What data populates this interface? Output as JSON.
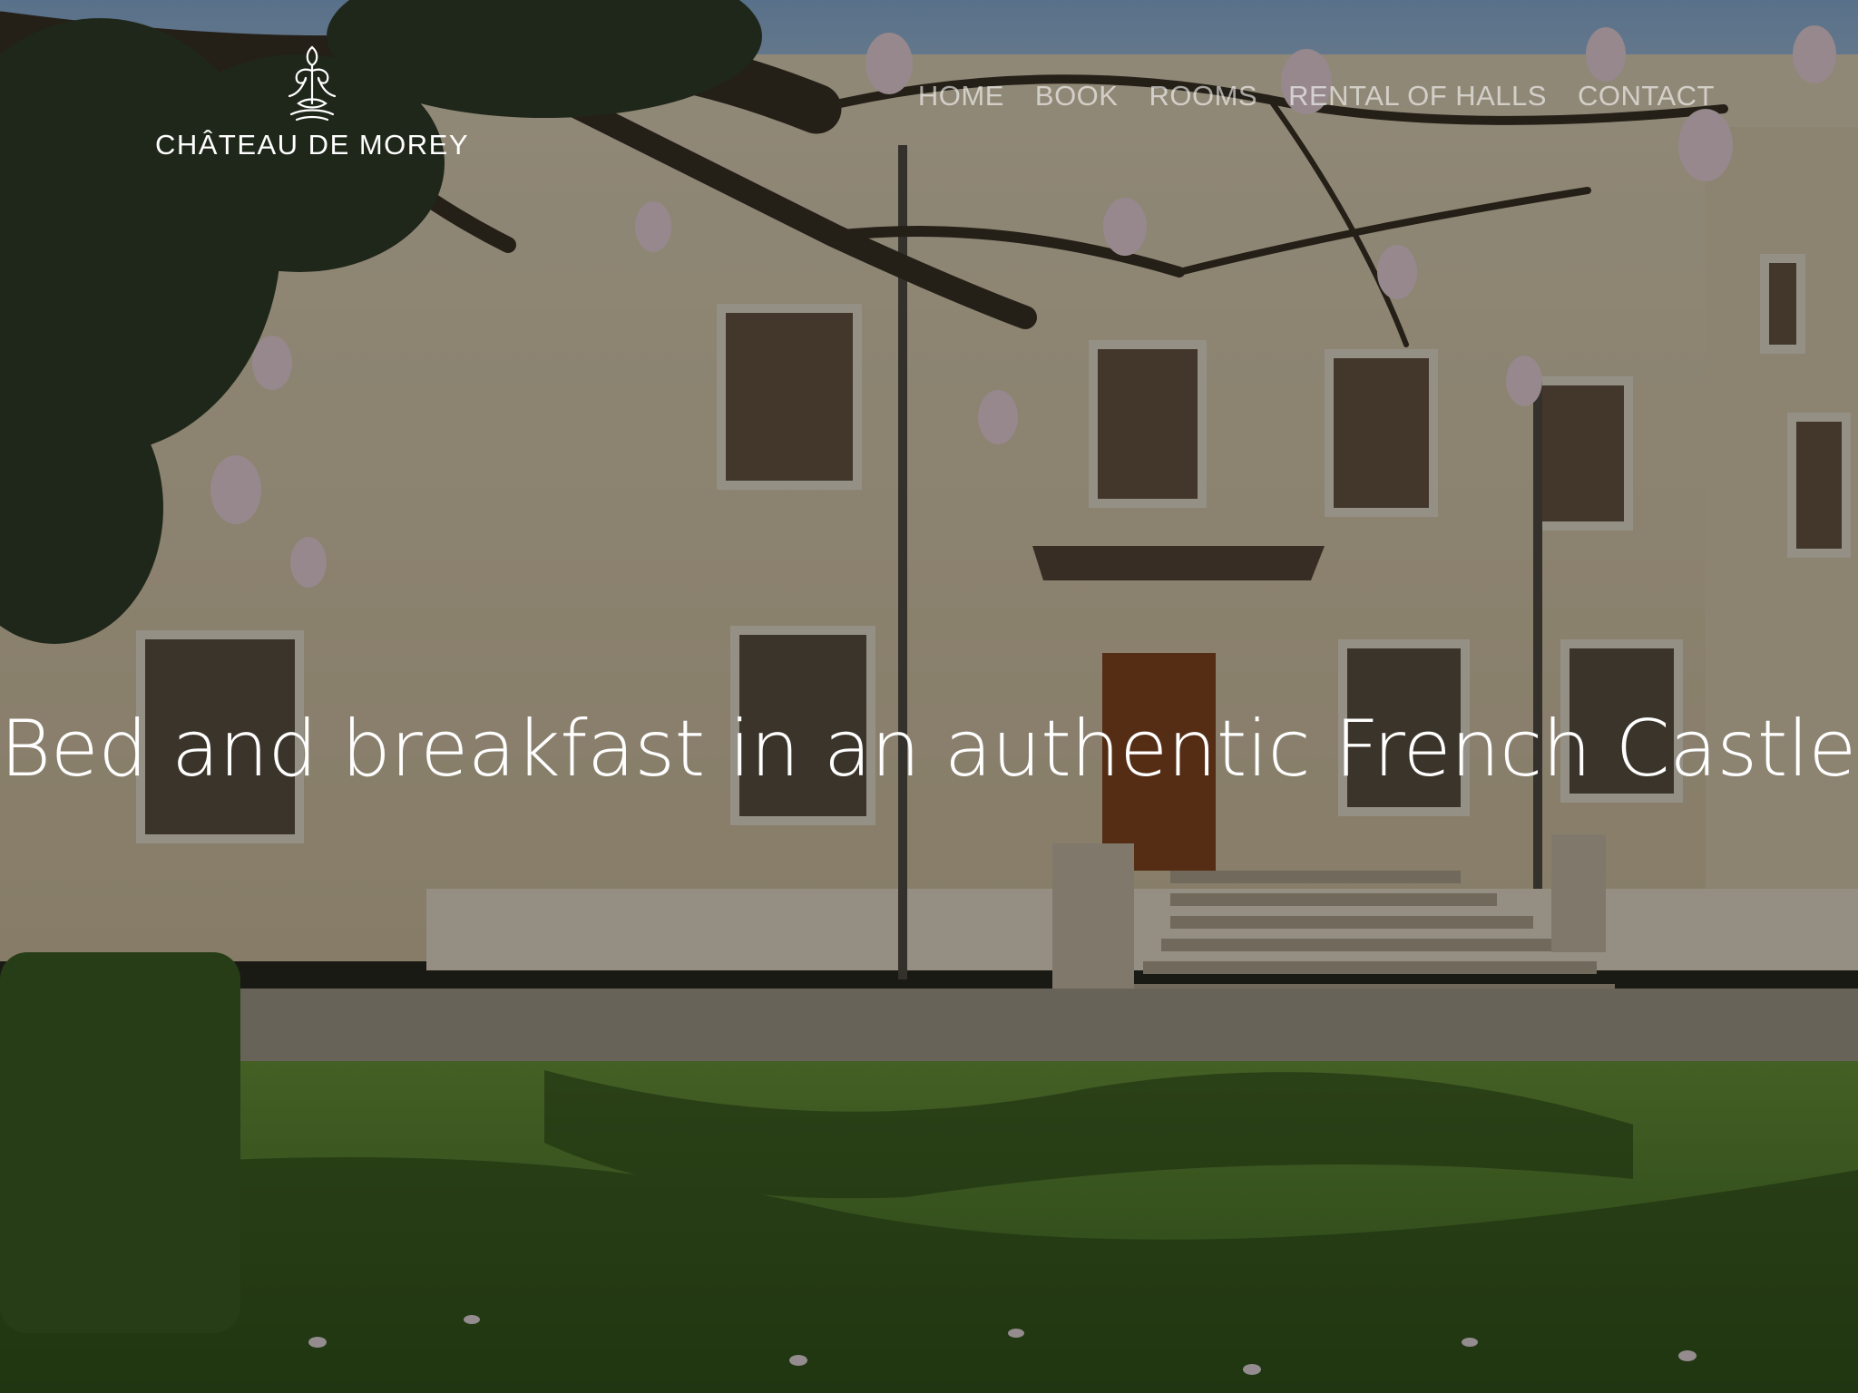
{
  "site": {
    "logo_text": "CHÂTEAU DE MOREY",
    "logo_icon": "fleur-crest-icon"
  },
  "nav": {
    "items": [
      {
        "label": "HOME"
      },
      {
        "label": "BOOK"
      },
      {
        "label": "ROOMS"
      },
      {
        "label": "RENTAL OF HALLS"
      },
      {
        "label": "CONTACT"
      }
    ]
  },
  "hero": {
    "headline": "Bed and breakfast in an authentic French Castle",
    "cursor": "|",
    "image": "chateau-facade-with-magnolia-tree"
  },
  "colors": {
    "text": "#ffffff",
    "nav_text": "#ffffffa0",
    "overlay": "#00000060"
  }
}
